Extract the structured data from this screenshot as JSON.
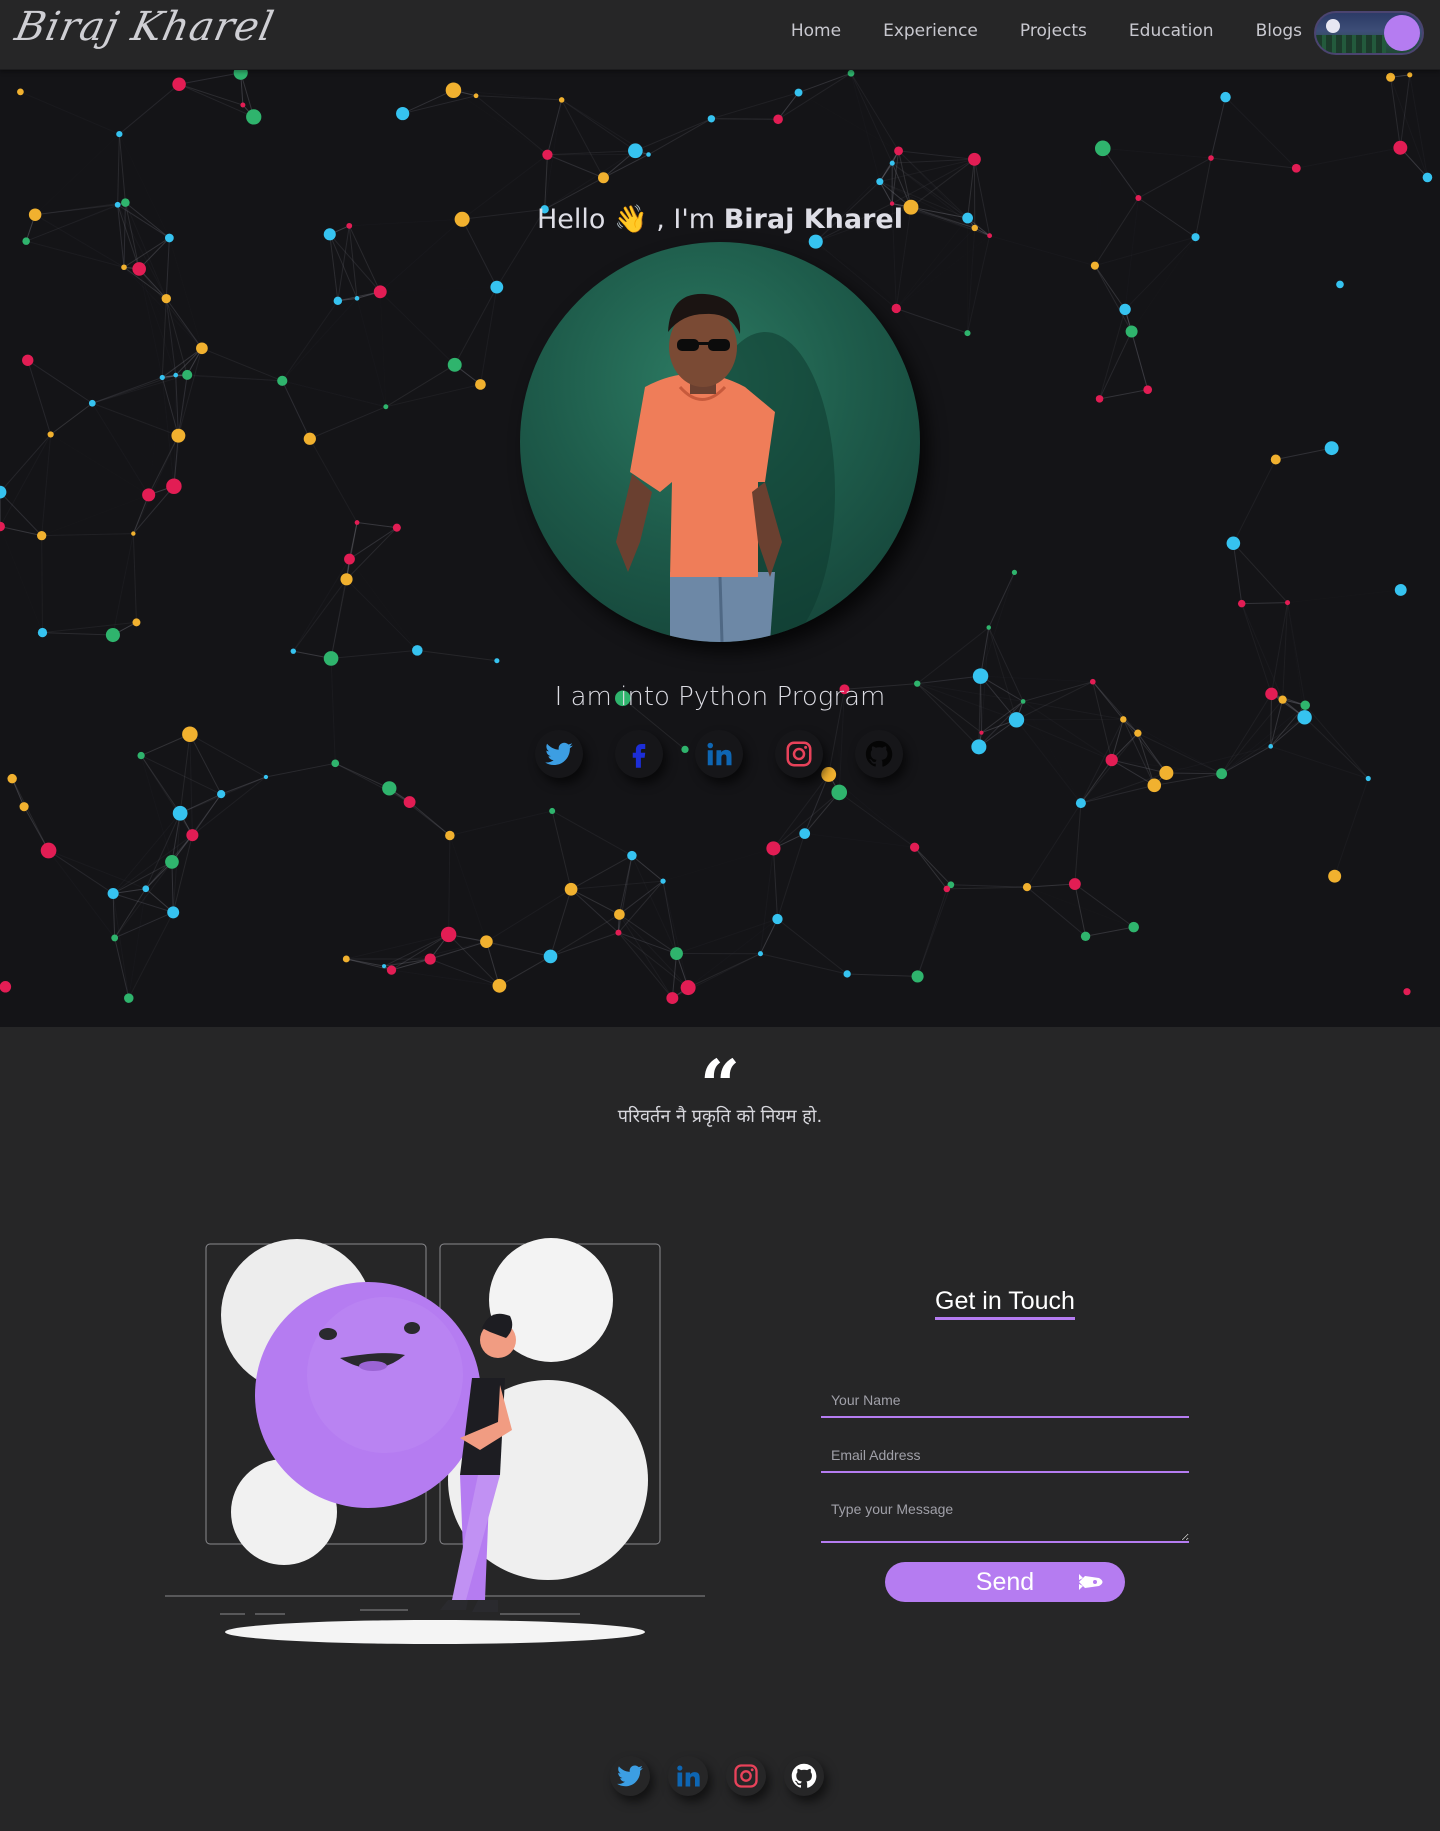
{
  "nav": {
    "logo": "Biraj Kharel",
    "links": [
      "Home",
      "Experience",
      "Projects",
      "Education",
      "Blogs"
    ],
    "theme_toggle": "night"
  },
  "hero": {
    "greeting_prefix": "Hello",
    "greeting_wave": "👋",
    "greeting_mid": ", I'm",
    "name": "Biraj Kharel",
    "tagline": "I am into Python Program",
    "socials": [
      "twitter-icon",
      "facebook-icon",
      "linkedin-icon",
      "instagram-icon",
      "github-icon"
    ]
  },
  "quote": {
    "mark": "“",
    "text": "परिवर्तन नै प्रकृति को नियम हो."
  },
  "contact": {
    "title": "Get in Touch",
    "name_placeholder": "Your Name",
    "email_placeholder": "Email Address",
    "message_placeholder": "Type your Message",
    "send_label": "Send"
  },
  "footer": {
    "socials": [
      "twitter-icon",
      "linkedin-icon",
      "instagram-icon",
      "github-icon"
    ]
  },
  "colors": {
    "accent": "#b57cf1",
    "background": "#262627",
    "hero_background": "#141417",
    "particle_colors": [
      "#e21d54",
      "#36c3f0",
      "#f1b12f",
      "#2fb46d"
    ],
    "twitter": "#3c9ee3",
    "linkedin": "#0e66b3",
    "instagram": "#e8425a",
    "facebook": "#1c2ed8"
  }
}
